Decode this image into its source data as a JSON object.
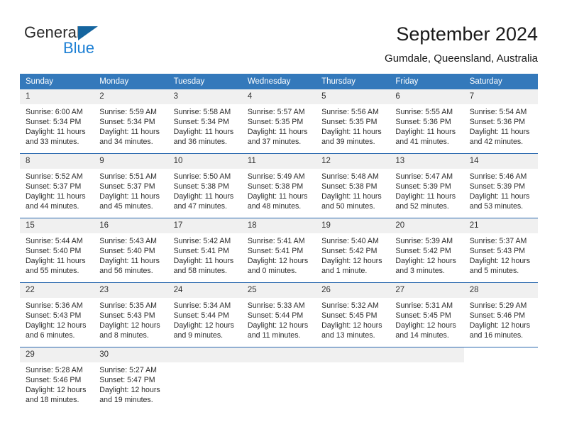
{
  "brand": {
    "name_part1": "General",
    "name_part2": "Blue",
    "accent_color": "#1c7fd4",
    "triangle_color": "#15659f"
  },
  "header": {
    "title": "September 2024",
    "subtitle": "Gumdale, Queensland, Australia"
  },
  "calendar": {
    "header_bg": "#3479bb",
    "daynum_bg": "#f0f0f0",
    "row_rule_color": "#2a68ae",
    "weekdays": [
      "Sunday",
      "Monday",
      "Tuesday",
      "Wednesday",
      "Thursday",
      "Friday",
      "Saturday"
    ],
    "weeks": [
      [
        {
          "day": "1",
          "sunrise": "Sunrise: 6:00 AM",
          "sunset": "Sunset: 5:34 PM",
          "daylight1": "Daylight: 11 hours",
          "daylight2": "and 33 minutes."
        },
        {
          "day": "2",
          "sunrise": "Sunrise: 5:59 AM",
          "sunset": "Sunset: 5:34 PM",
          "daylight1": "Daylight: 11 hours",
          "daylight2": "and 34 minutes."
        },
        {
          "day": "3",
          "sunrise": "Sunrise: 5:58 AM",
          "sunset": "Sunset: 5:34 PM",
          "daylight1": "Daylight: 11 hours",
          "daylight2": "and 36 minutes."
        },
        {
          "day": "4",
          "sunrise": "Sunrise: 5:57 AM",
          "sunset": "Sunset: 5:35 PM",
          "daylight1": "Daylight: 11 hours",
          "daylight2": "and 37 minutes."
        },
        {
          "day": "5",
          "sunrise": "Sunrise: 5:56 AM",
          "sunset": "Sunset: 5:35 PM",
          "daylight1": "Daylight: 11 hours",
          "daylight2": "and 39 minutes."
        },
        {
          "day": "6",
          "sunrise": "Sunrise: 5:55 AM",
          "sunset": "Sunset: 5:36 PM",
          "daylight1": "Daylight: 11 hours",
          "daylight2": "and 41 minutes."
        },
        {
          "day": "7",
          "sunrise": "Sunrise: 5:54 AM",
          "sunset": "Sunset: 5:36 PM",
          "daylight1": "Daylight: 11 hours",
          "daylight2": "and 42 minutes."
        }
      ],
      [
        {
          "day": "8",
          "sunrise": "Sunrise: 5:52 AM",
          "sunset": "Sunset: 5:37 PM",
          "daylight1": "Daylight: 11 hours",
          "daylight2": "and 44 minutes."
        },
        {
          "day": "9",
          "sunrise": "Sunrise: 5:51 AM",
          "sunset": "Sunset: 5:37 PM",
          "daylight1": "Daylight: 11 hours",
          "daylight2": "and 45 minutes."
        },
        {
          "day": "10",
          "sunrise": "Sunrise: 5:50 AM",
          "sunset": "Sunset: 5:38 PM",
          "daylight1": "Daylight: 11 hours",
          "daylight2": "and 47 minutes."
        },
        {
          "day": "11",
          "sunrise": "Sunrise: 5:49 AM",
          "sunset": "Sunset: 5:38 PM",
          "daylight1": "Daylight: 11 hours",
          "daylight2": "and 48 minutes."
        },
        {
          "day": "12",
          "sunrise": "Sunrise: 5:48 AM",
          "sunset": "Sunset: 5:38 PM",
          "daylight1": "Daylight: 11 hours",
          "daylight2": "and 50 minutes."
        },
        {
          "day": "13",
          "sunrise": "Sunrise: 5:47 AM",
          "sunset": "Sunset: 5:39 PM",
          "daylight1": "Daylight: 11 hours",
          "daylight2": "and 52 minutes."
        },
        {
          "day": "14",
          "sunrise": "Sunrise: 5:46 AM",
          "sunset": "Sunset: 5:39 PM",
          "daylight1": "Daylight: 11 hours",
          "daylight2": "and 53 minutes."
        }
      ],
      [
        {
          "day": "15",
          "sunrise": "Sunrise: 5:44 AM",
          "sunset": "Sunset: 5:40 PM",
          "daylight1": "Daylight: 11 hours",
          "daylight2": "and 55 minutes."
        },
        {
          "day": "16",
          "sunrise": "Sunrise: 5:43 AM",
          "sunset": "Sunset: 5:40 PM",
          "daylight1": "Daylight: 11 hours",
          "daylight2": "and 56 minutes."
        },
        {
          "day": "17",
          "sunrise": "Sunrise: 5:42 AM",
          "sunset": "Sunset: 5:41 PM",
          "daylight1": "Daylight: 11 hours",
          "daylight2": "and 58 minutes."
        },
        {
          "day": "18",
          "sunrise": "Sunrise: 5:41 AM",
          "sunset": "Sunset: 5:41 PM",
          "daylight1": "Daylight: 12 hours",
          "daylight2": "and 0 minutes."
        },
        {
          "day": "19",
          "sunrise": "Sunrise: 5:40 AM",
          "sunset": "Sunset: 5:42 PM",
          "daylight1": "Daylight: 12 hours",
          "daylight2": "and 1 minute."
        },
        {
          "day": "20",
          "sunrise": "Sunrise: 5:39 AM",
          "sunset": "Sunset: 5:42 PM",
          "daylight1": "Daylight: 12 hours",
          "daylight2": "and 3 minutes."
        },
        {
          "day": "21",
          "sunrise": "Sunrise: 5:37 AM",
          "sunset": "Sunset: 5:43 PM",
          "daylight1": "Daylight: 12 hours",
          "daylight2": "and 5 minutes."
        }
      ],
      [
        {
          "day": "22",
          "sunrise": "Sunrise: 5:36 AM",
          "sunset": "Sunset: 5:43 PM",
          "daylight1": "Daylight: 12 hours",
          "daylight2": "and 6 minutes."
        },
        {
          "day": "23",
          "sunrise": "Sunrise: 5:35 AM",
          "sunset": "Sunset: 5:43 PM",
          "daylight1": "Daylight: 12 hours",
          "daylight2": "and 8 minutes."
        },
        {
          "day": "24",
          "sunrise": "Sunrise: 5:34 AM",
          "sunset": "Sunset: 5:44 PM",
          "daylight1": "Daylight: 12 hours",
          "daylight2": "and 9 minutes."
        },
        {
          "day": "25",
          "sunrise": "Sunrise: 5:33 AM",
          "sunset": "Sunset: 5:44 PM",
          "daylight1": "Daylight: 12 hours",
          "daylight2": "and 11 minutes."
        },
        {
          "day": "26",
          "sunrise": "Sunrise: 5:32 AM",
          "sunset": "Sunset: 5:45 PM",
          "daylight1": "Daylight: 12 hours",
          "daylight2": "and 13 minutes."
        },
        {
          "day": "27",
          "sunrise": "Sunrise: 5:31 AM",
          "sunset": "Sunset: 5:45 PM",
          "daylight1": "Daylight: 12 hours",
          "daylight2": "and 14 minutes."
        },
        {
          "day": "28",
          "sunrise": "Sunrise: 5:29 AM",
          "sunset": "Sunset: 5:46 PM",
          "daylight1": "Daylight: 12 hours",
          "daylight2": "and 16 minutes."
        }
      ],
      [
        {
          "day": "29",
          "sunrise": "Sunrise: 5:28 AM",
          "sunset": "Sunset: 5:46 PM",
          "daylight1": "Daylight: 12 hours",
          "daylight2": "and 18 minutes."
        },
        {
          "day": "30",
          "sunrise": "Sunrise: 5:27 AM",
          "sunset": "Sunset: 5:47 PM",
          "daylight1": "Daylight: 12 hours",
          "daylight2": "and 19 minutes."
        },
        {
          "day": "",
          "sunrise": "",
          "sunset": "",
          "daylight1": "",
          "daylight2": ""
        },
        {
          "day": "",
          "sunrise": "",
          "sunset": "",
          "daylight1": "",
          "daylight2": ""
        },
        {
          "day": "",
          "sunrise": "",
          "sunset": "",
          "daylight1": "",
          "daylight2": ""
        },
        {
          "day": "",
          "sunrise": "",
          "sunset": "",
          "daylight1": "",
          "daylight2": ""
        },
        {
          "day": "",
          "sunrise": "",
          "sunset": "",
          "daylight1": "",
          "daylight2": ""
        }
      ]
    ]
  }
}
